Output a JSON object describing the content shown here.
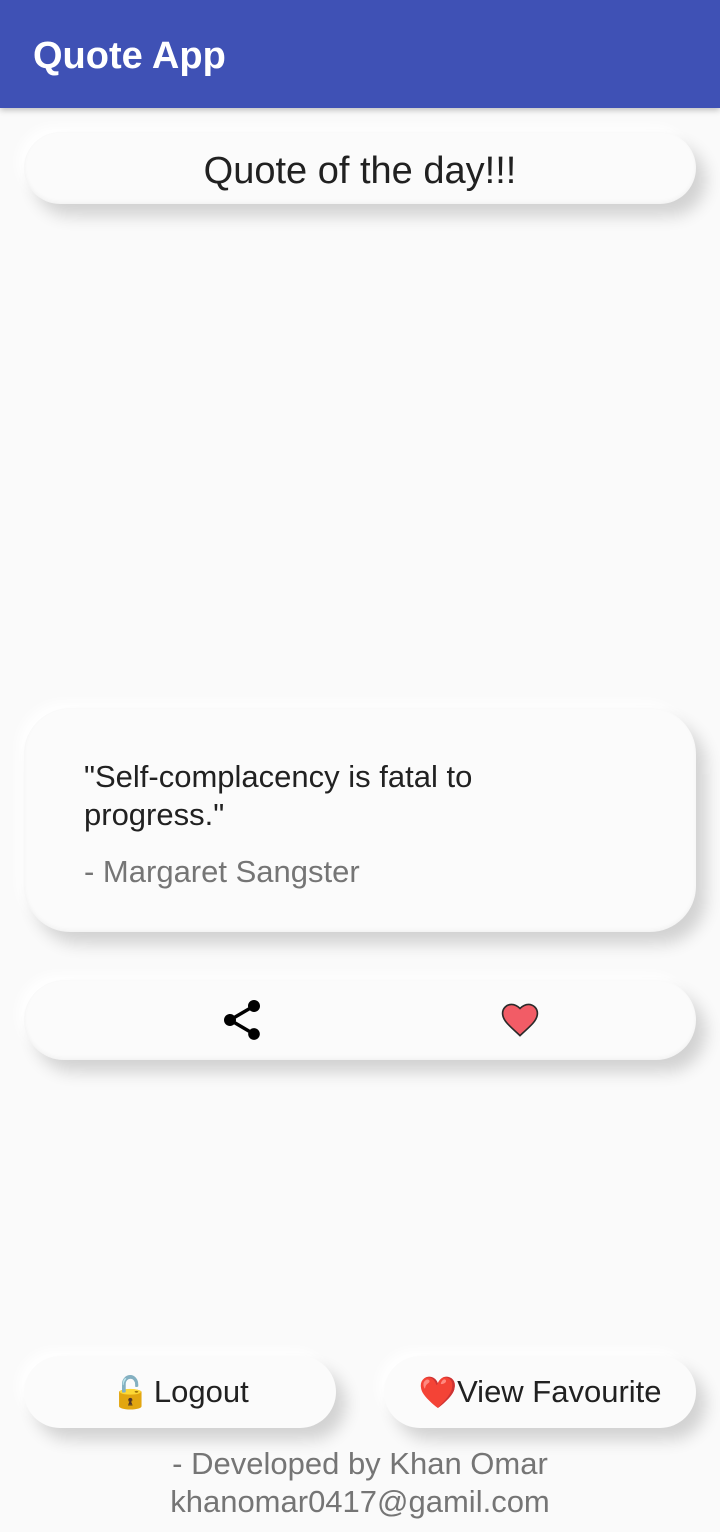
{
  "appbar": {
    "title": "Quote App",
    "color": "#3f51b5"
  },
  "header": {
    "text": "Quote of the day!!!"
  },
  "quote": {
    "text": "\"Self-complacency is fatal to progress.\"",
    "author": "- Margaret Sangster"
  },
  "actions": {
    "share_icon": "share-icon",
    "favourite_icon": "heart-icon"
  },
  "buttons": {
    "logout": {
      "icon": "🔓",
      "label": "Logout"
    },
    "view_favourite": {
      "icon": "❤️",
      "label": "View Favourite"
    }
  },
  "footer": {
    "line1": "- Developed by Khan Omar",
    "line2": "khanomar0417@gamil.com"
  }
}
